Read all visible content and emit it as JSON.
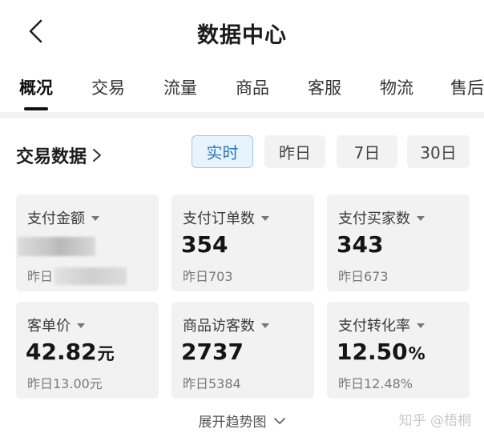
{
  "header": {
    "title": "数据中心"
  },
  "tabs": [
    {
      "label": "概况"
    },
    {
      "label": "交易"
    },
    {
      "label": "流量"
    },
    {
      "label": "商品"
    },
    {
      "label": "客服"
    },
    {
      "label": "物流"
    },
    {
      "label": "售后"
    }
  ],
  "section": {
    "title": "交易数据",
    "ranges": [
      "实时",
      "昨日",
      "7日",
      "30日"
    ]
  },
  "cards": [
    {
      "label": "支付金额",
      "value": "",
      "unit": "",
      "sub": "昨日"
    },
    {
      "label": "支付订单数",
      "value": "354",
      "unit": "",
      "sub": "昨日703"
    },
    {
      "label": "支付买家数",
      "value": "343",
      "unit": "",
      "sub": "昨日673"
    },
    {
      "label": "客单价",
      "value": "42.82",
      "unit": "元",
      "sub": "昨日13.00元"
    },
    {
      "label": "商品访客数",
      "value": "2737",
      "unit": "",
      "sub": "昨日5384"
    },
    {
      "label": "支付转化率",
      "value": "12.50",
      "unit": "%",
      "sub": "昨日12.48%"
    }
  ],
  "footer": {
    "expand_label": "展开趋势图"
  },
  "watermark": "知乎 @梧桐"
}
